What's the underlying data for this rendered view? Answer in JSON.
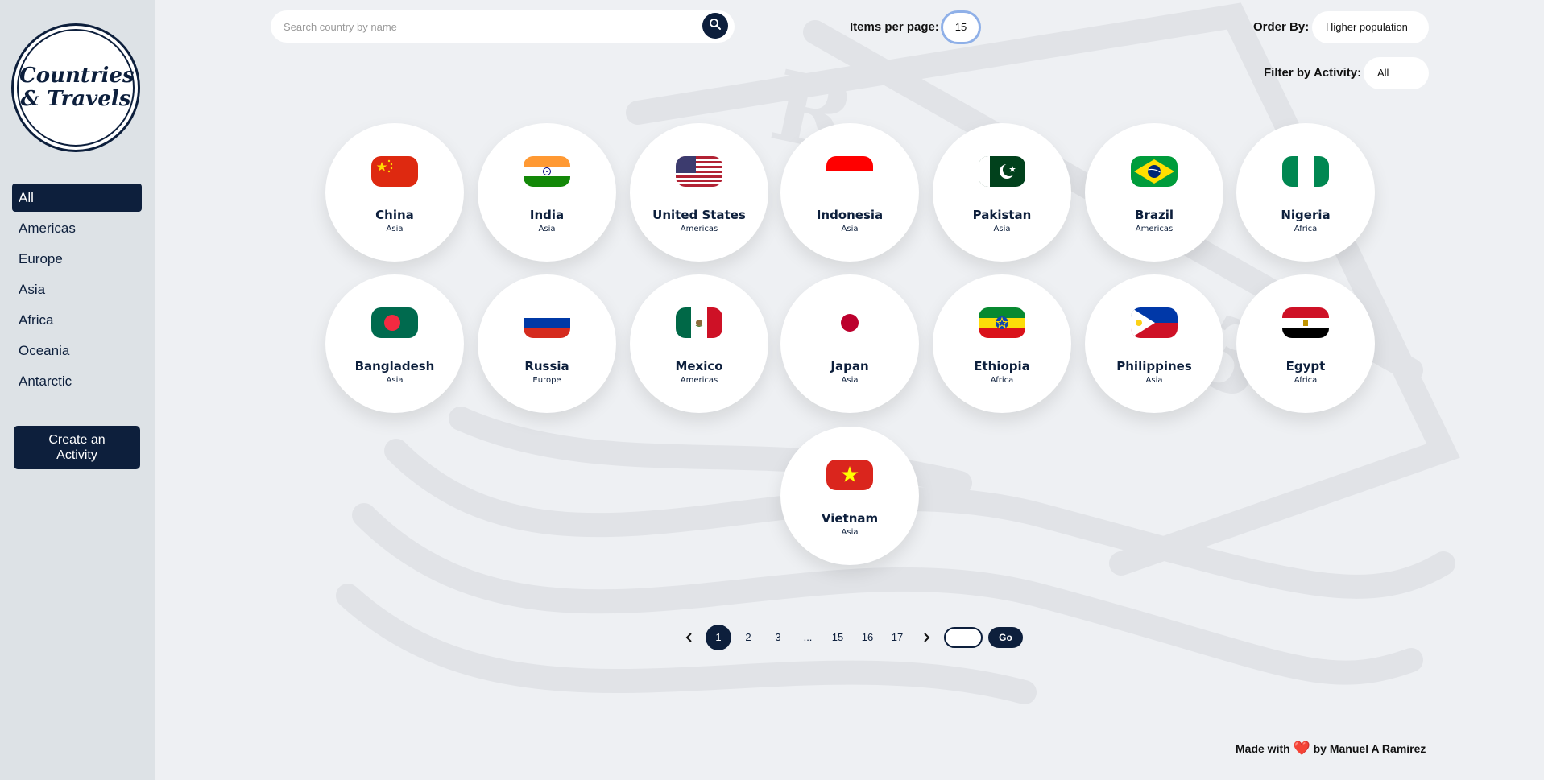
{
  "logo": {
    "line1": "Countries",
    "line2": "& Travels"
  },
  "nav": {
    "items": [
      {
        "label": "All"
      },
      {
        "label": "Americas"
      },
      {
        "label": "Europe"
      },
      {
        "label": "Asia"
      },
      {
        "label": "Africa"
      },
      {
        "label": "Oceania"
      },
      {
        "label": "Antarctic"
      }
    ]
  },
  "create_button": "Create an Activity",
  "search": {
    "placeholder": "Search country by name",
    "value": ""
  },
  "items_per_page": {
    "label": "Items per page:",
    "value": "15"
  },
  "order_by": {
    "label": "Order By:",
    "value": "Higher population"
  },
  "filter_activity": {
    "label": "Filter by Activity:",
    "value": "All"
  },
  "countries": [
    {
      "name": "China",
      "region": "Asia",
      "flag": "china-flag"
    },
    {
      "name": "India",
      "region": "Asia",
      "flag": "india-flag"
    },
    {
      "name": "United States",
      "region": "Americas",
      "flag": "usa-flag"
    },
    {
      "name": "Indonesia",
      "region": "Asia",
      "flag": "indonesia-flag"
    },
    {
      "name": "Pakistan",
      "region": "Asia",
      "flag": "pakistan-flag"
    },
    {
      "name": "Brazil",
      "region": "Americas",
      "flag": "brazil-flag"
    },
    {
      "name": "Nigeria",
      "region": "Africa",
      "flag": "nigeria-flag"
    },
    {
      "name": "Bangladesh",
      "region": "Asia",
      "flag": "bangladesh-flag"
    },
    {
      "name": "Russia",
      "region": "Europe",
      "flag": "russia-flag"
    },
    {
      "name": "Mexico",
      "region": "Americas",
      "flag": "mexico-flag"
    },
    {
      "name": "Japan",
      "region": "Asia",
      "flag": "japan-flag"
    },
    {
      "name": "Ethiopia",
      "region": "Africa",
      "flag": "ethiopia-flag"
    },
    {
      "name": "Philippines",
      "region": "Asia",
      "flag": "philippines-flag"
    },
    {
      "name": "Egypt",
      "region": "Africa",
      "flag": "egypt-flag"
    },
    {
      "name": "Vietnam",
      "region": "Asia",
      "flag": "vietnam-flag"
    }
  ],
  "pagination": {
    "pages": [
      "1",
      "2",
      "3",
      "...",
      "15",
      "16",
      "17"
    ],
    "current": "1",
    "go_label": "Go"
  },
  "footer": {
    "prefix": "Made with",
    "heart": "❤️",
    "suffix": "by Manuel A Ramirez"
  },
  "colors": {
    "primary": "#0d1f3c",
    "sidebar": "#dde2e6",
    "background": "#eef0f3",
    "accent_ring": "#8fb0e8"
  }
}
